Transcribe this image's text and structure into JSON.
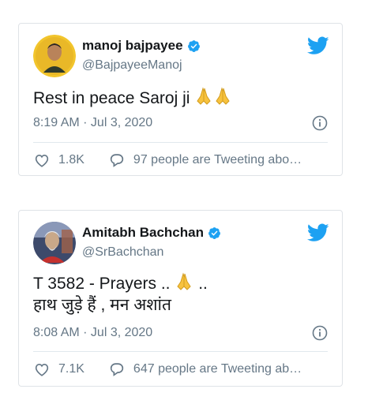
{
  "tweets": [
    {
      "name": "manoj bajpayee",
      "handle": "@BajpayeeManoj",
      "text": "Rest in peace Saroj ji",
      "time": "8:19 AM · Jul 3, 2020",
      "likes": "1.8K",
      "conversation": "97 people are Tweeting abo…"
    },
    {
      "name": "Amitabh Bachchan",
      "handle": "@SrBachchan",
      "text_line1": "T 3582 - Prayers ..",
      "text_line1_after": "..",
      "text_line2": "हाथ जुड़े हैं , मन अशांत",
      "time": "8:08 AM · Jul 3, 2020",
      "likes": "7.1K",
      "conversation": "647 people are Tweeting ab…"
    }
  ],
  "colors": {
    "twitter_blue": "#1da1f2",
    "secondary_text": "#657786",
    "border": "#dfe3e7"
  },
  "icons": [
    "verified-badge-icon",
    "twitter-bird-icon",
    "info-icon",
    "heart-icon",
    "reply-bubble-icon",
    "folded-hands-emoji"
  ]
}
